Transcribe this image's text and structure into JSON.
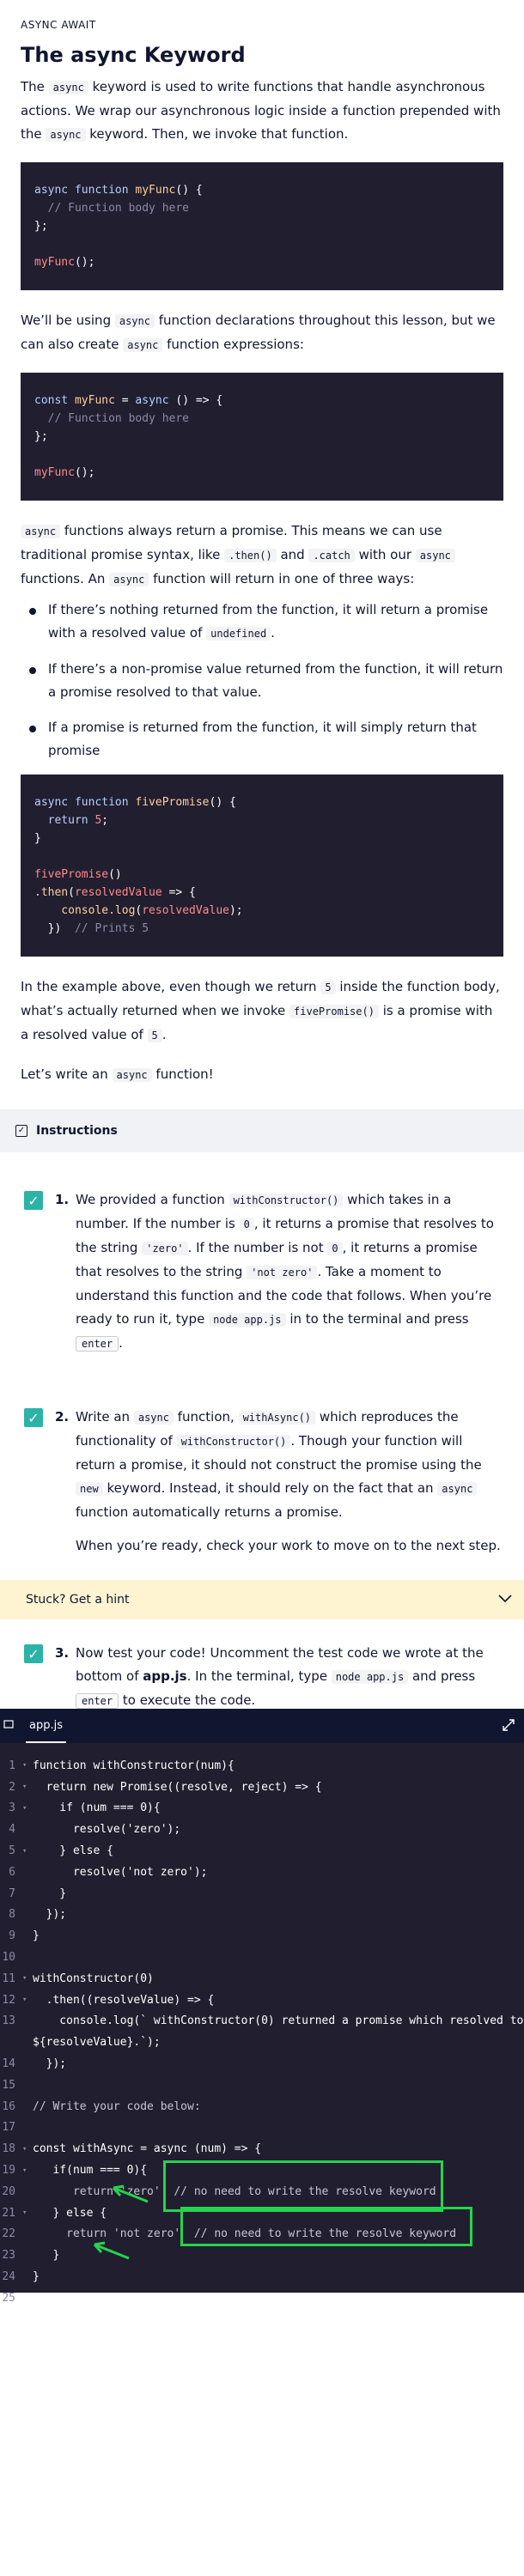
{
  "lesson": {
    "kicker": "ASYNC AWAIT",
    "title": "The async Keyword",
    "p1": {
      "a": "The ",
      "code1": "async",
      "b": " keyword is used to write functions that handle asynchronous actions. We wrap our asynchronous logic inside a function prepended with the ",
      "code2": "async",
      "c": " keyword. Then, we invoke that function."
    },
    "code1": {
      "l1a": "async function ",
      "l1b": "myFunc",
      "l1c": "() {",
      "l2": "  // Function body here",
      "l3": "};",
      "l5a": "myFunc",
      "l5b": "();"
    },
    "p2": {
      "a": "We’ll be using ",
      "code1": "async",
      "b": " function declarations throughout this lesson, but we can also create ",
      "code2": "async",
      "c": " function expressions:"
    },
    "code2": {
      "l1a": "const ",
      "l1b": "myFunc",
      "l1c": " = ",
      "l1d": "async",
      "l1e": " () => {",
      "l2": "  // Function body here",
      "l3": "};",
      "l5a": "myFunc",
      "l5b": "();"
    },
    "p3": {
      "code1": "async",
      "a": " functions always return a promise. This means we can use traditional promise syntax, like ",
      "code2": ".then()",
      "b": " and ",
      "code3": ".catch",
      "c": " with our ",
      "code4": "async",
      "d": " functions. An ",
      "code5": "async",
      "e": " function will return in one of three ways:"
    },
    "bullets": {
      "b1a": "If there’s nothing returned from the function, it will return a promise with a resolved value of ",
      "b1code": "undefined",
      "b1b": ".",
      "b2": "If there’s a non-promise value returned from the function, it will return a promise resolved to that value.",
      "b3": "If a promise is returned from the function, it will simply return that promise"
    },
    "code3": {
      "l1a": "async function ",
      "l1b": "fivePromise",
      "l1c": "() {",
      "l2a": "  return ",
      "l2b": "5",
      "l2c": ";",
      "l3": "}",
      "l5a": "fivePromise",
      "l5b": "()",
      "l6a": ".then",
      "l6b": "(",
      "l6c": "resolvedValue",
      "l6d": " => {",
      "l7a": "    console.log",
      "l7b": "(",
      "l7c": "resolvedValue",
      "l7d": ");",
      "l8a": "  })  ",
      "l8b": "// Prints 5"
    },
    "p4": {
      "a": "In the example above, even though we return ",
      "code1": "5",
      "b": " inside the function body, what’s actually returned when we invoke ",
      "code2": "fivePromise()",
      "c": " is a promise with a resolved value of ",
      "code3": "5",
      "d": "."
    },
    "p5": {
      "a": "Let’s write an ",
      "code1": "async",
      "b": " function!"
    }
  },
  "instructions": {
    "header": "Instructions",
    "checkmark": "✓",
    "task1": {
      "num": "1.",
      "a": "We provided a function ",
      "code1": "withConstructor()",
      "b": " which takes in a number. If the number is ",
      "code2": "0",
      "c": ", it returns a promise that resolves to the string ",
      "code3": "'zero'",
      "d": ". If the number is not ",
      "code4": "0",
      "e": ", it returns a promise that resolves to the string ",
      "code5": "'not zero'",
      "f": ". Take a moment to understand this function and the code that follows. When you’re ready to run it, type ",
      "code6": "node app.js",
      "g": " in to the terminal and press ",
      "kbd": "enter",
      "h": "."
    },
    "task2": {
      "num": "2.",
      "a": "Write an ",
      "code1": "async",
      "b": " function, ",
      "code2": "withAsync()",
      "c": " which reproduces the functionality of ",
      "code3": "withConstructor()",
      "d": ". Though your function will return a promise, it should not construct the promise using the ",
      "code4": "new",
      "e": " keyword. Instead, it should rely on the fact that an ",
      "code5": "async",
      "f": " function automatically returns a promise.",
      "p2": "When you’re ready, check your work to move on to the next step."
    },
    "hint": "Stuck? Get a hint",
    "task3": {
      "num": "3.",
      "a": "Now test your code! Uncomment the test code we wrote at the bottom of ",
      "bold": "app.js",
      "b": ". In the terminal, type ",
      "code1": "node app.js",
      "c": " and press ",
      "kbd": "enter",
      "d": " to execute the code."
    }
  },
  "editor": {
    "tab": "app.js",
    "lines": [
      {
        "n": "1",
        "fold": "▾",
        "t": "function withConstructor(num){"
      },
      {
        "n": "2",
        "fold": "▾",
        "t": "  return new Promise((resolve, reject) => {"
      },
      {
        "n": "3",
        "fold": "▾",
        "t": "    if (num === 0){"
      },
      {
        "n": "4",
        "fold": "",
        "t": "      resolve('zero');"
      },
      {
        "n": "5",
        "fold": "▾",
        "t": "    } else {"
      },
      {
        "n": "6",
        "fold": "",
        "t": "      resolve('not zero');"
      },
      {
        "n": "7",
        "fold": "",
        "t": "    }"
      },
      {
        "n": "8",
        "fold": "",
        "t": "  });"
      },
      {
        "n": "9",
        "fold": "",
        "t": "}"
      },
      {
        "n": "10",
        "fold": "",
        "t": ""
      },
      {
        "n": "11",
        "fold": "▾",
        "t": "withConstructor(0)"
      },
      {
        "n": "12",
        "fold": "▾",
        "t": "  .then((resolveValue) => {"
      },
      {
        "n": "13",
        "fold": "",
        "t": "    console.log(` withConstructor(0) returned a promise which resolved to:"
      },
      {
        "n": "",
        "fold": "",
        "t": "${resolveValue}.`);"
      },
      {
        "n": "14",
        "fold": "",
        "t": "  });"
      },
      {
        "n": "15",
        "fold": "",
        "t": ""
      },
      {
        "n": "16",
        "fold": "",
        "t": "// Write your code below:"
      },
      {
        "n": "17",
        "fold": "",
        "t": ""
      },
      {
        "n": "18",
        "fold": "▾",
        "t": "const withAsync = async (num) => {"
      },
      {
        "n": "19",
        "fold": "▾",
        "t": "   if(num === 0){"
      },
      {
        "n": "20",
        "fold": "",
        "t": "      return 'zero'  // no need to write the resolve keyword"
      },
      {
        "n": "21",
        "fold": "▾",
        "t": "   } else {"
      },
      {
        "n": "22",
        "fold": "",
        "t": "     return 'not zero'  // no need to write the resolve keyword"
      },
      {
        "n": "23",
        "fold": "",
        "t": "   }"
      },
      {
        "n": "24",
        "fold": "",
        "t": "}"
      },
      {
        "n": "25",
        "fold": "",
        "t": ""
      }
    ]
  },
  "colors": {
    "accent": "#2ab3a6",
    "annotation": "#26d34f",
    "code_bg": "#211e2f",
    "hint_bg": "#fff4d2"
  }
}
